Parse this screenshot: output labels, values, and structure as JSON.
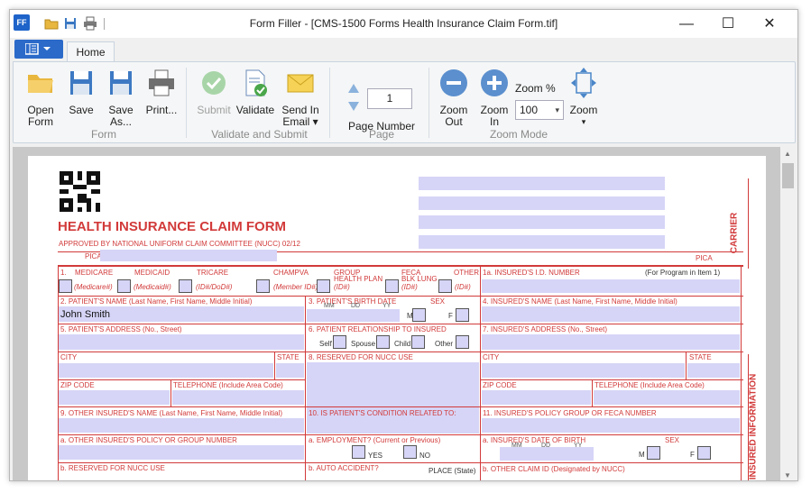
{
  "window": {
    "title": "Form Filler - [CMS-1500 Forms Health Insurance Claim Form.tif]",
    "app_icon": "FF",
    "minimize": "—",
    "maximize": "☐",
    "close": "✕"
  },
  "tabs": {
    "home": "Home"
  },
  "ribbon": {
    "open_line1": "Open",
    "open_line2": "Form",
    "save": "Save",
    "saveas_line1": "Save",
    "saveas_line2": "As...",
    "print": "Print...",
    "group_form": "Form",
    "submit": "Submit",
    "validate": "Validate",
    "send_line1": "Send In",
    "send_line2": "Email ▾",
    "group_validate": "Validate and Submit",
    "page_value": "1",
    "page_label": "Page Number",
    "group_page": "Page",
    "zoomout_line1": "Zoom",
    "zoomout_line2": "Out",
    "zoomin_line1": "Zoom",
    "zoomin_line2": "In",
    "zoom_pct_label": "Zoom %",
    "zoom_value": "100",
    "zoom": "Zoom",
    "zoom_caret": "▾",
    "group_zoom": "Zoom Mode"
  },
  "form": {
    "title": "HEALTH INSURANCE CLAIM FORM",
    "approved": "APPROVED BY NATIONAL UNIFORM CLAIM COMMITTEE (NUCC) 02/12",
    "pica_left": "PICA",
    "pica_right": "PICA",
    "carrier": "CARRIER",
    "insured_info": "D INSURED INFORMATION",
    "f1": "1.",
    "medicare": "MEDICARE",
    "medicaid": "MEDICAID",
    "tricare": "TRICARE",
    "champva": "CHAMPVA",
    "group_health": "GROUP",
    "group_health2": "HEALTH PLAN",
    "feca": "FECA",
    "feca2": "BLK LUNG",
    "other": "OTHER",
    "medicare_id": "(Medicare#)",
    "medicaid_id": "(Medicaid#)",
    "tricare_id": "(ID#/DoD#)",
    "champva_id": "(Member ID#)",
    "group_id": "(ID#)",
    "feca_id": "(ID#)",
    "other_id": "(ID#)",
    "f1a": "1a. INSURED'S I.D. NUMBER",
    "f1a_note": "(For Program in Item 1)",
    "f2": "2. PATIENT'S NAME (Last Name, First Name, Middle Initial)",
    "f2_value": "John Smith",
    "f3": "3. PATIENT'S BIRTH DATE",
    "f3_mm": "MM",
    "f3_dd": "DD",
    "f3_yy": "YY",
    "f3_sex": "SEX",
    "f3_m": "M",
    "f3_f": "F",
    "f4": "4. INSURED'S NAME (Last Name, First Name, Middle Initial)",
    "f5": "5. PATIENT'S ADDRESS (No., Street)",
    "f6": "6. PATIENT RELATIONSHIP TO INSURED",
    "f6_self": "Self",
    "f6_spouse": "Spouse",
    "f6_child": "Child",
    "f6_other": "Other",
    "f7": "7. INSURED'S ADDRESS (No., Street)",
    "city": "CITY",
    "state": "STATE",
    "f8": "8. RESERVED FOR NUCC USE",
    "city2": "CITY",
    "state2": "STATE",
    "zip": "ZIP CODE",
    "tel": "TELEPHONE (Include Area Code)",
    "zip2": "ZIP CODE",
    "tel2": "TELEPHONE (Include Area Code)",
    "f9": "9. OTHER INSURED'S NAME (Last Name, First Name, Middle Initial)",
    "f10": "10. IS PATIENT'S CONDITION RELATED TO:",
    "f11": "11. INSURED'S POLICY GROUP OR FECA NUMBER",
    "f9a": "a. OTHER INSURED'S POLICY OR GROUP NUMBER",
    "f10a": "a. EMPLOYMENT? (Current or Previous)",
    "yes": "YES",
    "no": "NO",
    "f11a": "a. INSURED'S DATE OF BIRTH",
    "f11a_mm": "MM",
    "f11a_dd": "DD",
    "f11a_yy": "YY",
    "f11a_sex": "SEX",
    "f11a_m": "M",
    "f11a_f": "F",
    "f9b": "b. RESERVED FOR NUCC USE",
    "f10b": "b. AUTO ACCIDENT?",
    "place": "PLACE (State)",
    "f11b": "b. OTHER CLAIM ID (Designated by NUCC)"
  }
}
